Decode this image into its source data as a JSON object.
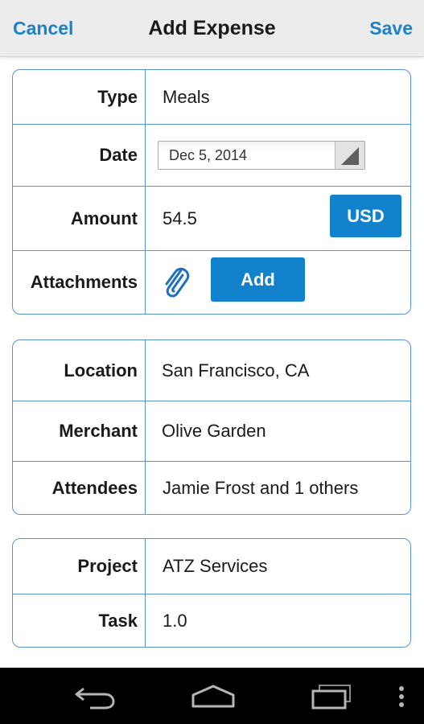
{
  "header": {
    "cancel_label": "Cancel",
    "title": "Add Expense",
    "save_label": "Save"
  },
  "section1": {
    "type_label": "Type",
    "type_value": "Meals",
    "date_label": "Date",
    "date_value": "Dec 5, 2014",
    "amount_label": "Amount",
    "amount_value": "54.5",
    "currency_label": "USD",
    "attachments_label": "Attachments",
    "add_label": "Add"
  },
  "section2": {
    "location_label": "Location",
    "location_value": "San Francisco, CA",
    "merchant_label": "Merchant",
    "merchant_value": "Olive Garden",
    "attendees_label": "Attendees",
    "attendees_value": "Jamie Frost and 1 others"
  },
  "section3": {
    "project_label": "Project",
    "project_value": "ATZ Services",
    "task_label": "Task",
    "task_value": "1.0"
  },
  "colors": {
    "accent": "#1a82c8",
    "button": "#1181cc",
    "border": "#5a93d3"
  },
  "icons": [
    "paperclip-icon",
    "dropdown-caret-icon",
    "back-icon",
    "home-icon",
    "recent-apps-icon",
    "overflow-menu-icon"
  ]
}
